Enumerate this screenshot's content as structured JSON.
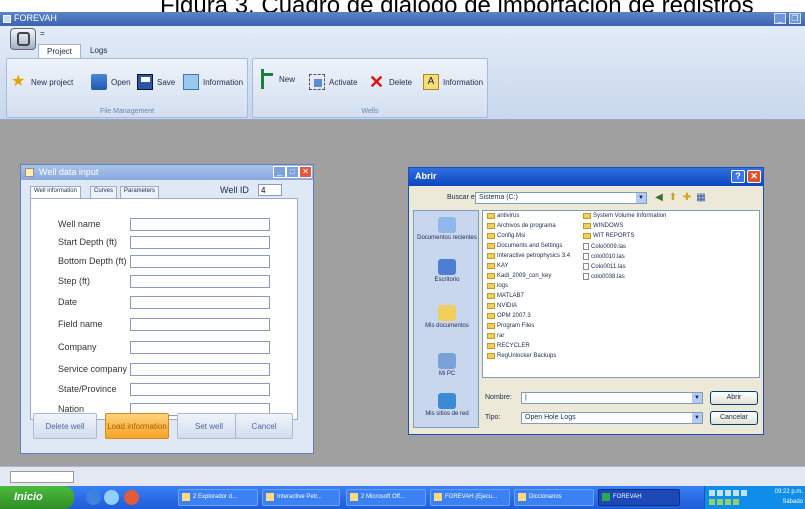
{
  "caption": "Figura 3. Cuadro de diálogo de importación de registros",
  "app": {
    "title": "FOREVAH",
    "tabs": [
      "Project",
      "Logs"
    ],
    "qat_mark": "="
  },
  "ribbon": {
    "groups": [
      {
        "label": "File Management",
        "buttons": [
          "New project",
          "Open",
          "Save",
          "Information"
        ]
      },
      {
        "label": "Wells",
        "buttons": [
          "New",
          "Activate",
          "Delete",
          "Information"
        ]
      }
    ]
  },
  "well_dialog": {
    "title": "Well data input",
    "tabs": [
      "Well information",
      "Curves",
      "Parameters"
    ],
    "well_id_label": "Well ID",
    "well_id_value": "4",
    "fields": [
      "Well name",
      "Start Depth (ft)",
      "Bottom Depth (ft)",
      "Step (ft)",
      "Date",
      "Field name",
      "Company",
      "Service company",
      "State/Province",
      "Nation"
    ],
    "buttons": [
      "Delete well",
      "Load information",
      "Set well",
      "Cancel"
    ],
    "highlighted_button": "Load information"
  },
  "open_dialog": {
    "title": "Abrir",
    "look_in_label": "Buscar en:",
    "look_in_value": "Sistema (C:)",
    "places": [
      "Documentos recientes",
      "Escritorio",
      "Mis documentos",
      "Mi PC",
      "Mis sitios de red"
    ],
    "files_col1": [
      "antivirus",
      "Archivos de programa",
      "Config.Msi",
      "Documents and Settings",
      "Interactive petrophysics 3.4",
      "KAY",
      "Kadi_2009_con_key",
      "logs",
      "MATLAB7",
      "NVIDIA",
      "OPM 2007.3",
      "Program Files",
      "rar",
      "RECYCLER",
      "RegUnlocker Backups"
    ],
    "files_col2": [
      "System Volume Information",
      "WINDOWS",
      "WIT REPORTS",
      "Colo0009.las",
      "colo0010.las",
      "Colo0011.las",
      "colo0038.las"
    ],
    "name_label": "Nombre:",
    "name_value": "|",
    "type_label": "Tipo:",
    "type_value": "Open Hole Logs",
    "open_button": "Abrir",
    "cancel_button": "Cancelar"
  },
  "taskbar": {
    "start": "Inicio",
    "tasks": [
      "2 Explorador d...",
      "Interactive Petr...",
      "2 Microsoft Off...",
      "FOREVAH (Ejecu...",
      "Diccionarios",
      "FOREVAH"
    ],
    "active_task": "FOREVAH",
    "clock": "09:22 p.m.",
    "day": "Sábado"
  }
}
